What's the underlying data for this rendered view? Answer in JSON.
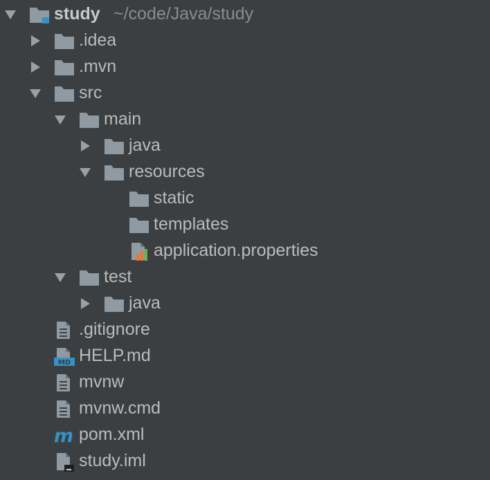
{
  "project_tree": {
    "root": {
      "label": "study",
      "path": "~/code/Java/study"
    },
    "items": [
      {
        "label": ".idea"
      },
      {
        "label": ".mvn"
      },
      {
        "label": "src"
      },
      {
        "label": "main"
      },
      {
        "label": "java"
      },
      {
        "label": "resources"
      },
      {
        "label": "static"
      },
      {
        "label": "templates"
      },
      {
        "label": "application.properties"
      },
      {
        "label": "test"
      },
      {
        "label": "java"
      },
      {
        "label": ".gitignore"
      },
      {
        "label": "HELP.md"
      },
      {
        "label": "mvnw"
      },
      {
        "label": "mvnw.cmd"
      },
      {
        "label": "pom.xml"
      },
      {
        "label": "study.iml"
      }
    ]
  },
  "colors": {
    "background": "#3c3f41",
    "text": "#bbbbbb",
    "path_text": "#8a8c8e",
    "folder": "#8f9aa3",
    "module_accent": "#3592c4",
    "maven_icon": "#3592c4",
    "md_badge": "#3592c4"
  },
  "icons": {
    "expanded": "triangle-down",
    "collapsed": "triangle-right",
    "module": "module-folder",
    "folder": "folder",
    "text_file": "text-file",
    "properties_file": "properties-file",
    "markdown_file": "markdown-file",
    "maven_file": "maven-file",
    "iml_file": "iml-file"
  }
}
